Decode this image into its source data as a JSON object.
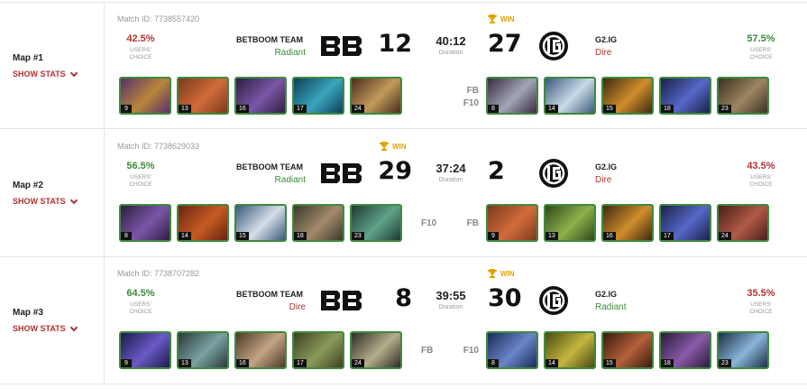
{
  "matches": [
    {
      "map": "Map #1",
      "show_stats": "SHOW STATS",
      "match_id": "Match ID: 7738557420",
      "left_pct": "42.5%",
      "left_pct_color": "#b03232",
      "right_pct": "57.5%",
      "right_pct_color": "#3f8a3f",
      "choice": [
        "USERS'",
        "CHOICE"
      ],
      "team_left": "BETBOOM TEAM",
      "side_left": "Radiant",
      "side_left_color": "#3f8a3f",
      "score_left": "12",
      "duration": "40:12",
      "duration_label": "Duration",
      "score_right": "27",
      "team_right": "G2.IG",
      "side_right": "Dire",
      "side_right_color": "#b03232",
      "win": "WIN",
      "win_side": "right",
      "left_badges": [],
      "right_badges": [
        "FB",
        "F10"
      ],
      "heroes_left": [
        {
          "num": "9",
          "c1": "#5a2f6b",
          "c2": "#b9873a"
        },
        {
          "num": "13",
          "c1": "#7a3a1a",
          "c2": "#d26b3c"
        },
        {
          "num": "16",
          "c1": "#2c1f3f",
          "c2": "#7b56a8"
        },
        {
          "num": "17",
          "c1": "#0d3f58",
          "c2": "#3aa4bd"
        },
        {
          "num": "24",
          "c1": "#4a2d1a",
          "c2": "#c29a5c"
        }
      ],
      "heroes_right": [
        {
          "num": "8",
          "c1": "#3a2a44",
          "c2": "#a1a6b4"
        },
        {
          "num": "14",
          "c1": "#3b5a7a",
          "c2": "#c9d9e8"
        },
        {
          "num": "15",
          "c1": "#3d2a10",
          "c2": "#d08d2c"
        },
        {
          "num": "18",
          "c1": "#1a2248",
          "c2": "#5667c7"
        },
        {
          "num": "23",
          "c1": "#3b3020",
          "c2": "#9d8662"
        }
      ]
    },
    {
      "map": "Map #2",
      "show_stats": "SHOW STATS",
      "match_id": "Match ID: 7738629033",
      "left_pct": "56.5%",
      "left_pct_color": "#3f8a3f",
      "right_pct": "43.5%",
      "right_pct_color": "#b03232",
      "choice": [
        "USERS'",
        "CHOICE"
      ],
      "team_left": "BETBOOM TEAM",
      "side_left": "Radiant",
      "side_left_color": "#3f8a3f",
      "score_left": "29",
      "duration": "37:24",
      "duration_label": "Duration",
      "score_right": "2",
      "team_right": "G2.IG",
      "side_right": "Dire",
      "side_right_color": "#b03232",
      "win": "WIN",
      "win_side": "left",
      "left_badges": [
        "F10"
      ],
      "right_badges": [
        "FB"
      ],
      "heroes_left": [
        {
          "num": "8",
          "c1": "#2c1f3f",
          "c2": "#7b56a8"
        },
        {
          "num": "14",
          "c1": "#6a2412",
          "c2": "#c65a22"
        },
        {
          "num": "15",
          "c1": "#3b5a7a",
          "c2": "#d6dde8"
        },
        {
          "num": "18",
          "c1": "#3a3a2a",
          "c2": "#a28a6a"
        },
        {
          "num": "23",
          "c1": "#1e3a30",
          "c2": "#5fa48a"
        }
      ],
      "heroes_right": [
        {
          "num": "9",
          "c1": "#7a3a1a",
          "c2": "#d26b3c"
        },
        {
          "num": "13",
          "c1": "#2f4a1c",
          "c2": "#8fb04a"
        },
        {
          "num": "16",
          "c1": "#3d2a10",
          "c2": "#d08d2c"
        },
        {
          "num": "17",
          "c1": "#1a2248",
          "c2": "#5667c7"
        },
        {
          "num": "24",
          "c1": "#4a1e18",
          "c2": "#b05a48"
        }
      ]
    },
    {
      "map": "Map #3",
      "show_stats": "SHOW STATS",
      "match_id": "Match ID: 7738707282",
      "left_pct": "64.5%",
      "left_pct_color": "#3f8a3f",
      "right_pct": "35.5%",
      "right_pct_color": "#b03232",
      "choice": [
        "USERS'",
        "CHOICE"
      ],
      "team_left": "BETBOOM TEAM",
      "side_left": "Dire",
      "side_left_color": "#b03232",
      "score_left": "8",
      "duration": "39:55",
      "duration_label": "Duration",
      "score_right": "30",
      "team_right": "G2.IG",
      "side_right": "Radiant",
      "side_right_color": "#3f8a3f",
      "win": "WIN",
      "win_side": "right",
      "left_badges": [
        "FB"
      ],
      "right_badges": [
        "F10"
      ],
      "heroes_left": [
        {
          "num": "9",
          "c1": "#1c1a4a",
          "c2": "#6a5ac6"
        },
        {
          "num": "13",
          "c1": "#2a3a3a",
          "c2": "#7aa0a0"
        },
        {
          "num": "16",
          "c1": "#4a3a2a",
          "c2": "#c4a484"
        },
        {
          "num": "17",
          "c1": "#3a4020",
          "c2": "#8c9a5a"
        },
        {
          "num": "24",
          "c1": "#2c2c24",
          "c2": "#b4ae8c"
        }
      ],
      "heroes_right": [
        {
          "num": "8",
          "c1": "#1a2a58",
          "c2": "#6a86c8"
        },
        {
          "num": "14",
          "c1": "#4a4a10",
          "c2": "#c4b640"
        },
        {
          "num": "15",
          "c1": "#3a1a10",
          "c2": "#b4603a"
        },
        {
          "num": "18",
          "c1": "#2a1a3a",
          "c2": "#8a5aa8"
        },
        {
          "num": "23",
          "c1": "#1a3048",
          "c2": "#8ab4d8"
        }
      ]
    }
  ]
}
